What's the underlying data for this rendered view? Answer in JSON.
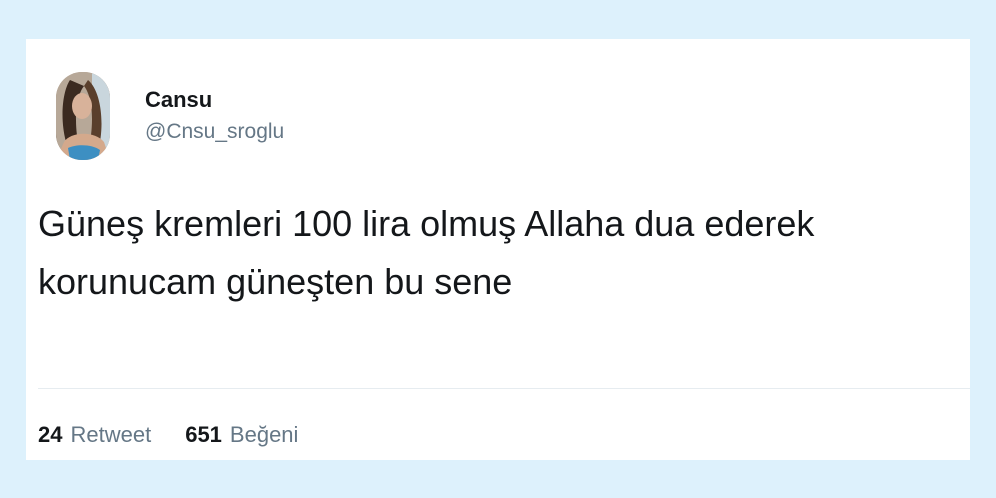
{
  "tweet": {
    "author": {
      "display_name": "Cansu",
      "handle": "@Cnsu_sroglu"
    },
    "text_line1": "Güneş kremleri 100 lira olmuş Allaha dua ederek",
    "text_line2": "korunucam güneşten bu sene",
    "stats": {
      "retweet_count": "24",
      "retweet_label": "Retweet",
      "like_count": "651",
      "like_label": "Beğeni"
    }
  }
}
